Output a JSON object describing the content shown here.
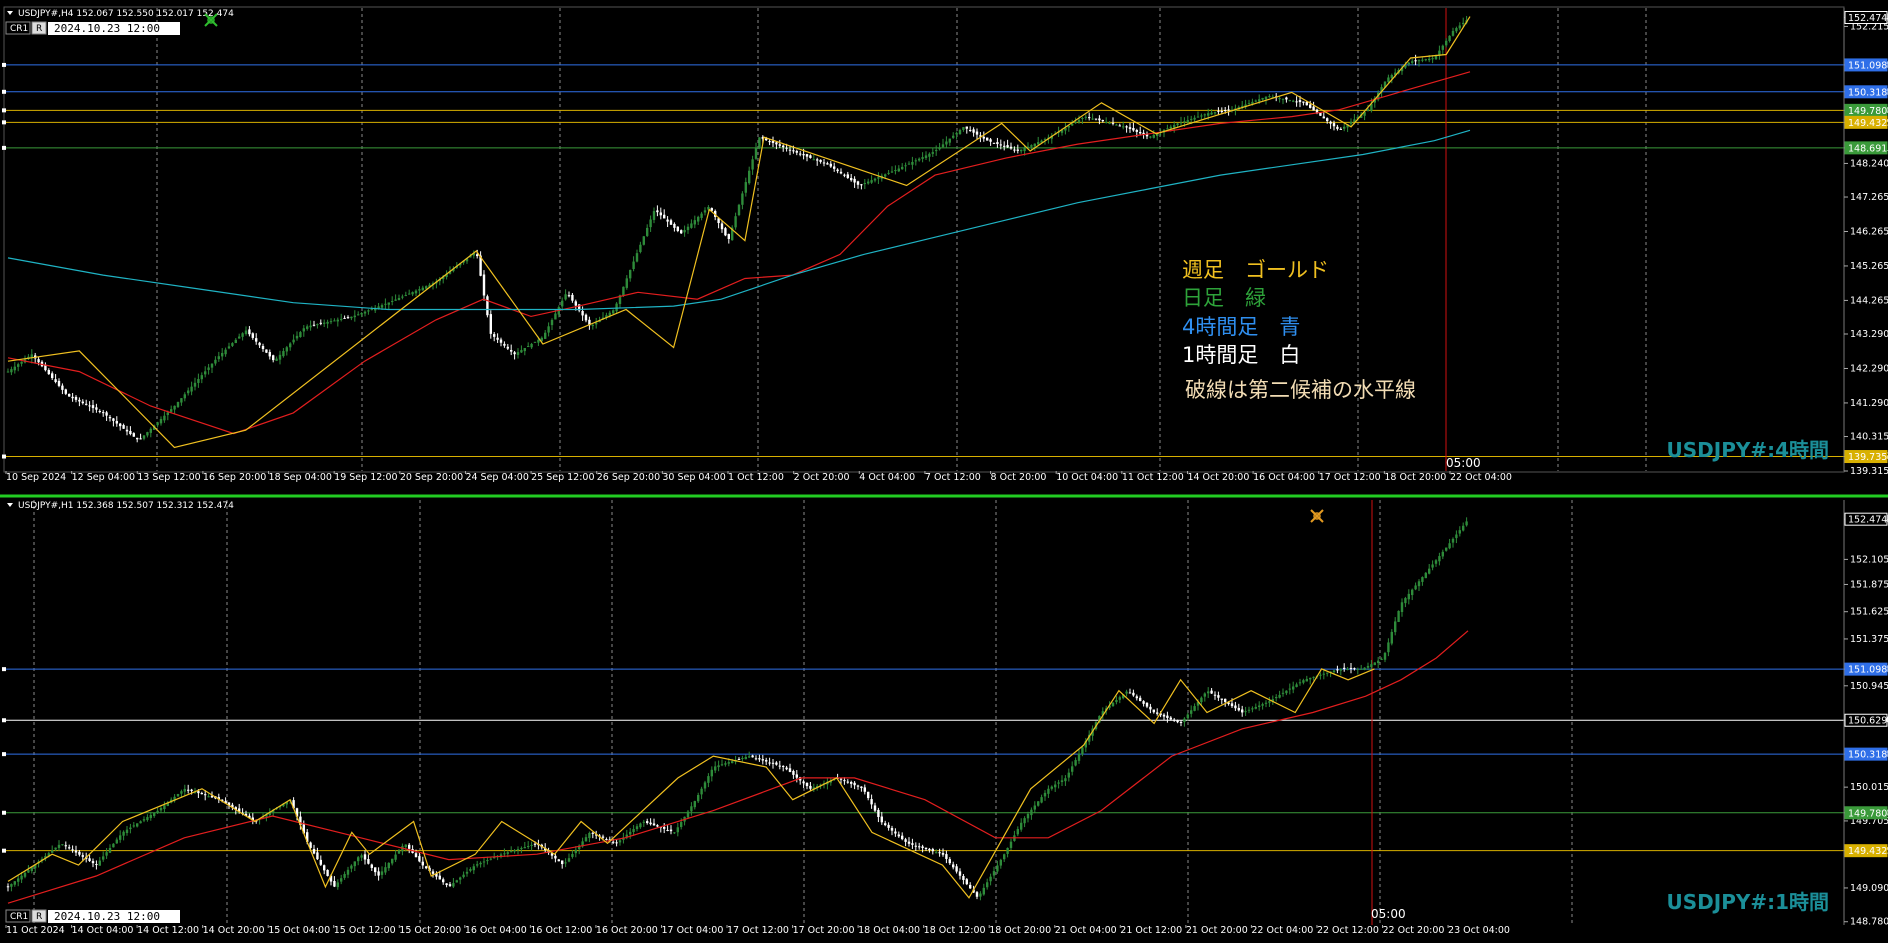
{
  "colors": {
    "background": "#000000",
    "bull_candle": "#2e8b3a",
    "bear_candle": "#ffffff",
    "ma_short": "#e21e1e",
    "ma_long": "#1fb3c4",
    "zigzag": "#f0c020",
    "level_blue": "#2f6fe8",
    "level_gold": "#d8b000",
    "level_green": "#3a9a3a",
    "level_white": "#ffffff",
    "vline_red": "#d01010",
    "grid": "#8a8a8a",
    "separator": "#22cc22"
  },
  "icons": [
    "chart-menu-triangle-icon",
    "one-click-trading-icon",
    "trade-arrow-icon"
  ],
  "top_panel": {
    "symbol_line": "USDJPY#,H4  152.067 152.550 152.017 152.474",
    "cr_label": "CR1",
    "r_label": "R",
    "date_box": "2024.10.23 12:00",
    "watermark": "USDJPY#:4時間",
    "vline_label": "05:00",
    "legend": [
      {
        "text": "週足　ゴールド",
        "color": "#f0c020"
      },
      {
        "text": "日足　緑",
        "color": "#2ea33a"
      },
      {
        "text": "4時間足　青",
        "color": "#2f8ff0"
      },
      {
        "text": "1時間足　白",
        "color": "#ffffff"
      },
      {
        "text": "破線は第二候補の水平線",
        "color": "#f2dcb4"
      }
    ]
  },
  "bottom_panel": {
    "symbol_line": "USDJPY#,H1  152.368 152.507 152.312 152.474",
    "cr_label": "CR1",
    "r_label": "R",
    "date_box": "2024.10.23 12:00",
    "watermark": "USDJPY#:1時間",
    "vline_label": "05:00"
  },
  "chart_data": [
    {
      "type": "candlestick",
      "title": "USDJPY#,H4",
      "ylim": [
        139.315,
        152.75
      ],
      "y_ticks": [
        "152.474",
        "152.215",
        "151.098",
        "150.318",
        "149.780",
        "149.432",
        "148.691",
        "148.240",
        "147.265",
        "146.265",
        "145.265",
        "144.265",
        "143.290",
        "142.290",
        "141.290",
        "140.315",
        "139.735",
        "139.315"
      ],
      "x_ticks": [
        "10 Sep 2024",
        "12 Sep 04:00",
        "13 Sep 12:00",
        "16 Sep 20:00",
        "18 Sep 04:00",
        "19 Sep 12:00",
        "20 Sep 20:00",
        "24 Sep 04:00",
        "25 Sep 12:00",
        "26 Sep 20:00",
        "30 Sep 04:00",
        "1 Oct 12:00",
        "2 Oct 20:00",
        "4 Oct 04:00",
        "7 Oct 12:00",
        "8 Oct 20:00",
        "10 Oct 04:00",
        "11 Oct 12:00",
        "14 Oct 20:00",
        "16 Oct 04:00",
        "17 Oct 12:00",
        "18 Oct 20:00",
        "22 Oct 04:00"
      ],
      "price_path": [
        [
          0,
          142.2
        ],
        [
          10,
          142.7
        ],
        [
          25,
          141.5
        ],
        [
          40,
          141.0
        ],
        [
          55,
          140.2
        ],
        [
          70,
          141.2
        ],
        [
          88,
          142.6
        ],
        [
          100,
          143.4
        ],
        [
          112,
          142.5
        ],
        [
          125,
          143.5
        ],
        [
          145,
          143.8
        ],
        [
          160,
          144.2
        ],
        [
          180,
          144.8
        ],
        [
          197,
          145.7
        ],
        [
          203,
          143.3
        ],
        [
          213,
          142.7
        ],
        [
          225,
          143.2
        ],
        [
          235,
          144.5
        ],
        [
          245,
          143.5
        ],
        [
          255,
          144.0
        ],
        [
          272,
          146.9
        ],
        [
          283,
          146.2
        ],
        [
          295,
          147.0
        ],
        [
          303,
          146.0
        ],
        [
          316,
          149.0
        ],
        [
          330,
          148.6
        ],
        [
          345,
          148.2
        ],
        [
          358,
          147.6
        ],
        [
          375,
          148.1
        ],
        [
          390,
          148.6
        ],
        [
          402,
          149.3
        ],
        [
          412,
          148.9
        ],
        [
          425,
          148.6
        ],
        [
          438,
          149.0
        ],
        [
          453,
          149.6
        ],
        [
          470,
          149.3
        ],
        [
          480,
          149.0
        ],
        [
          492,
          149.4
        ],
        [
          505,
          149.7
        ],
        [
          515,
          149.8
        ],
        [
          530,
          150.2
        ],
        [
          545,
          150.0
        ],
        [
          560,
          149.2
        ],
        [
          572,
          149.8
        ],
        [
          580,
          150.7
        ],
        [
          590,
          151.2
        ],
        [
          600,
          151.3
        ],
        [
          608,
          152.1
        ],
        [
          615,
          152.47
        ]
      ],
      "zigzag": [
        [
          0,
          142.5
        ],
        [
          30,
          142.8
        ],
        [
          70,
          140.0
        ],
        [
          100,
          140.5
        ],
        [
          197,
          145.7
        ],
        [
          225,
          143.0
        ],
        [
          260,
          144.0
        ],
        [
          280,
          142.9
        ],
        [
          295,
          146.9
        ],
        [
          310,
          146.0
        ],
        [
          318,
          149.0
        ],
        [
          378,
          147.6
        ],
        [
          418,
          149.4
        ],
        [
          430,
          148.6
        ],
        [
          460,
          150.0
        ],
        [
          483,
          149.1
        ],
        [
          540,
          150.3
        ],
        [
          565,
          149.3
        ],
        [
          590,
          151.3
        ],
        [
          605,
          151.4
        ],
        [
          615,
          152.5
        ]
      ],
      "series": [
        {
          "name": "",
          "color": "#e21e1e",
          "values": [
            [
              0,
              142.6
            ],
            [
              30,
              142.2
            ],
            [
              60,
              141.2
            ],
            [
              95,
              140.4
            ],
            [
              120,
              141.0
            ],
            [
              150,
              142.5
            ],
            [
              180,
              143.7
            ],
            [
              200,
              144.3
            ],
            [
              220,
              143.8
            ],
            [
              240,
              144.1
            ],
            [
              265,
              144.5
            ],
            [
              290,
              144.3
            ],
            [
              310,
              144.9
            ],
            [
              330,
              145.0
            ],
            [
              350,
              145.6
            ],
            [
              370,
              147.0
            ],
            [
              390,
              147.9
            ],
            [
              420,
              148.4
            ],
            [
              450,
              148.8
            ],
            [
              480,
              149.1
            ],
            [
              510,
              149.4
            ],
            [
              540,
              149.6
            ],
            [
              560,
              149.8
            ],
            [
              580,
              150.2
            ],
            [
              600,
              150.6
            ],
            [
              615,
              150.9
            ]
          ]
        },
        {
          "name": "",
          "color": "#1fb3c4",
          "values": [
            [
              0,
              145.5
            ],
            [
              40,
              145.0
            ],
            [
              80,
              144.6
            ],
            [
              120,
              144.2
            ],
            [
              160,
              144.0
            ],
            [
              200,
              144.0
            ],
            [
              240,
              144.0
            ],
            [
              280,
              144.1
            ],
            [
              300,
              144.3
            ],
            [
              330,
              145.0
            ],
            [
              360,
              145.6
            ],
            [
              390,
              146.1
            ],
            [
              420,
              146.6
            ],
            [
              450,
              147.1
            ],
            [
              480,
              147.5
            ],
            [
              510,
              147.9
            ],
            [
              540,
              148.2
            ],
            [
              570,
              148.5
            ],
            [
              600,
              148.9
            ],
            [
              615,
              149.2
            ]
          ]
        }
      ],
      "levels": [
        {
          "price": 151.098,
          "color": "#2f6fe8",
          "style": "solid"
        },
        {
          "price": 150.318,
          "color": "#2f6fe8",
          "style": "solid"
        },
        {
          "price": 149.78,
          "color": "#d8b000",
          "style": "solid"
        },
        {
          "price": 149.432,
          "color": "#d8b000",
          "style": "solid"
        },
        {
          "price": 148.691,
          "color": "#3a9a3a",
          "style": "solid"
        },
        {
          "price": 139.735,
          "color": "#d8b000",
          "style": "solid"
        }
      ],
      "level_badges": [
        {
          "text": "151.098",
          "color": "#2f6fe8",
          "price": 151.098
        },
        {
          "text": "150.318",
          "color": "#2f6fe8",
          "price": 150.318
        },
        {
          "text": "149.780",
          "color": "#3a9a3a",
          "price": 149.78
        },
        {
          "text": "149.432",
          "color": "#d8b000",
          "price": 149.432
        },
        {
          "text": "148.691",
          "color": "#3a9a3a",
          "price": 148.691
        },
        {
          "text": "139.735",
          "color": "#d8b000",
          "price": 139.735
        },
        {
          "text": "152.474",
          "color": "#ffffff",
          "price": 152.474
        }
      ]
    },
    {
      "type": "candlestick",
      "title": "USDJPY#,H1",
      "ylim": [
        148.75,
        152.65
      ],
      "y_ticks": [
        "152.474",
        "152.105",
        "151.875",
        "151.625",
        "151.375",
        "151.098",
        "150.945",
        "150.629",
        "150.318",
        "150.015",
        "149.780",
        "149.705",
        "149.432",
        "149.090",
        "148.780"
      ],
      "x_ticks": [
        "11 Oct 2024",
        "14 Oct 04:00",
        "14 Oct 12:00",
        "14 Oct 20:00",
        "15 Oct 04:00",
        "15 Oct 12:00",
        "15 Oct 20:00",
        "16 Oct 04:00",
        "16 Oct 12:00",
        "16 Oct 20:00",
        "17 Oct 04:00",
        "17 Oct 12:00",
        "17 Oct 20:00",
        "18 Oct 04:00",
        "18 Oct 12:00",
        "18 Oct 20:00",
        "21 Oct 04:00",
        "21 Oct 12:00",
        "21 Oct 20:00",
        "22 Oct 04:00",
        "22 Oct 12:00",
        "22 Oct 20:00",
        "23 Oct 04:00"
      ],
      "price_path": [
        [
          0,
          149.1
        ],
        [
          15,
          149.3
        ],
        [
          30,
          149.5
        ],
        [
          50,
          149.3
        ],
        [
          65,
          149.6
        ],
        [
          85,
          149.8
        ],
        [
          100,
          150.0
        ],
        [
          120,
          149.9
        ],
        [
          140,
          149.7
        ],
        [
          160,
          149.9
        ],
        [
          170,
          149.5
        ],
        [
          185,
          149.1
        ],
        [
          200,
          149.4
        ],
        [
          210,
          149.2
        ],
        [
          225,
          149.5
        ],
        [
          235,
          149.3
        ],
        [
          250,
          149.1
        ],
        [
          265,
          149.3
        ],
        [
          280,
          149.4
        ],
        [
          300,
          149.5
        ],
        [
          315,
          149.3
        ],
        [
          330,
          149.6
        ],
        [
          345,
          149.5
        ],
        [
          360,
          149.7
        ],
        [
          378,
          149.6
        ],
        [
          390,
          149.9
        ],
        [
          400,
          150.2
        ],
        [
          420,
          150.3
        ],
        [
          440,
          150.2
        ],
        [
          455,
          150.0
        ],
        [
          470,
          150.1
        ],
        [
          485,
          150.0
        ],
        [
          495,
          149.7
        ],
        [
          510,
          149.5
        ],
        [
          530,
          149.4
        ],
        [
          550,
          149.0
        ],
        [
          565,
          149.4
        ],
        [
          575,
          149.7
        ],
        [
          590,
          150.0
        ],
        [
          600,
          150.1
        ],
        [
          610,
          150.4
        ],
        [
          620,
          150.7
        ],
        [
          635,
          150.9
        ],
        [
          650,
          150.7
        ],
        [
          665,
          150.6
        ],
        [
          680,
          150.9
        ],
        [
          700,
          150.7
        ],
        [
          715,
          150.8
        ],
        [
          735,
          151.0
        ],
        [
          755,
          151.1
        ],
        [
          768,
          151.1
        ],
        [
          780,
          151.2
        ],
        [
          790,
          151.7
        ],
        [
          800,
          151.9
        ],
        [
          815,
          152.2
        ],
        [
          828,
          152.47
        ]
      ],
      "zigzag": [
        [
          0,
          149.15
        ],
        [
          25,
          149.4
        ],
        [
          40,
          149.3
        ],
        [
          65,
          149.7
        ],
        [
          110,
          150.0
        ],
        [
          140,
          149.7
        ],
        [
          160,
          149.9
        ],
        [
          180,
          149.1
        ],
        [
          195,
          149.6
        ],
        [
          205,
          149.4
        ],
        [
          230,
          149.7
        ],
        [
          240,
          149.2
        ],
        [
          265,
          149.4
        ],
        [
          280,
          149.7
        ],
        [
          310,
          149.4
        ],
        [
          325,
          149.7
        ],
        [
          340,
          149.5
        ],
        [
          380,
          150.1
        ],
        [
          400,
          150.3
        ],
        [
          430,
          150.2
        ],
        [
          445,
          149.9
        ],
        [
          470,
          150.1
        ],
        [
          490,
          149.6
        ],
        [
          530,
          149.3
        ],
        [
          545,
          149.0
        ],
        [
          580,
          150.0
        ],
        [
          610,
          150.4
        ],
        [
          630,
          150.9
        ],
        [
          650,
          150.6
        ],
        [
          665,
          151.0
        ],
        [
          680,
          150.7
        ],
        [
          705,
          150.9
        ],
        [
          730,
          150.7
        ],
        [
          745,
          151.1
        ],
        [
          760,
          151.0
        ],
        [
          775,
          151.1
        ]
      ],
      "series": [
        {
          "name": "",
          "color": "#e21e1e",
          "values": [
            [
              0,
              148.95
            ],
            [
              50,
              149.2
            ],
            [
              100,
              149.55
            ],
            [
              150,
              149.75
            ],
            [
              200,
              149.55
            ],
            [
              250,
              149.35
            ],
            [
              300,
              149.4
            ],
            [
              350,
              149.55
            ],
            [
              400,
              149.8
            ],
            [
              450,
              150.1
            ],
            [
              480,
              150.1
            ],
            [
              520,
              149.9
            ],
            [
              560,
              149.55
            ],
            [
              590,
              149.55
            ],
            [
              620,
              149.8
            ],
            [
              660,
              150.3
            ],
            [
              700,
              150.55
            ],
            [
              740,
              150.7
            ],
            [
              770,
              150.85
            ],
            [
              790,
              151.0
            ],
            [
              810,
              151.2
            ],
            [
              828,
              151.45
            ]
          ]
        }
      ],
      "levels": [
        {
          "price": 151.098,
          "color": "#2f6fe8",
          "style": "solid"
        },
        {
          "price": 150.629,
          "color": "#ffffff",
          "style": "solid"
        },
        {
          "price": 150.318,
          "color": "#2f6fe8",
          "style": "solid"
        },
        {
          "price": 149.78,
          "color": "#3a9a3a",
          "style": "solid"
        },
        {
          "price": 149.432,
          "color": "#d8b000",
          "style": "solid"
        }
      ],
      "level_badges": [
        {
          "text": "151.098",
          "color": "#2f6fe8",
          "price": 151.098
        },
        {
          "text": "150.629",
          "color": "#ffffff",
          "price": 150.629
        },
        {
          "text": "150.318",
          "color": "#2f6fe8",
          "price": 150.318
        },
        {
          "text": "149.780",
          "color": "#3a9a3a",
          "price": 149.78
        },
        {
          "text": "149.432",
          "color": "#d8b000",
          "price": 149.432
        },
        {
          "text": "152.474",
          "color": "#ffffff",
          "price": 152.474
        }
      ]
    }
  ]
}
